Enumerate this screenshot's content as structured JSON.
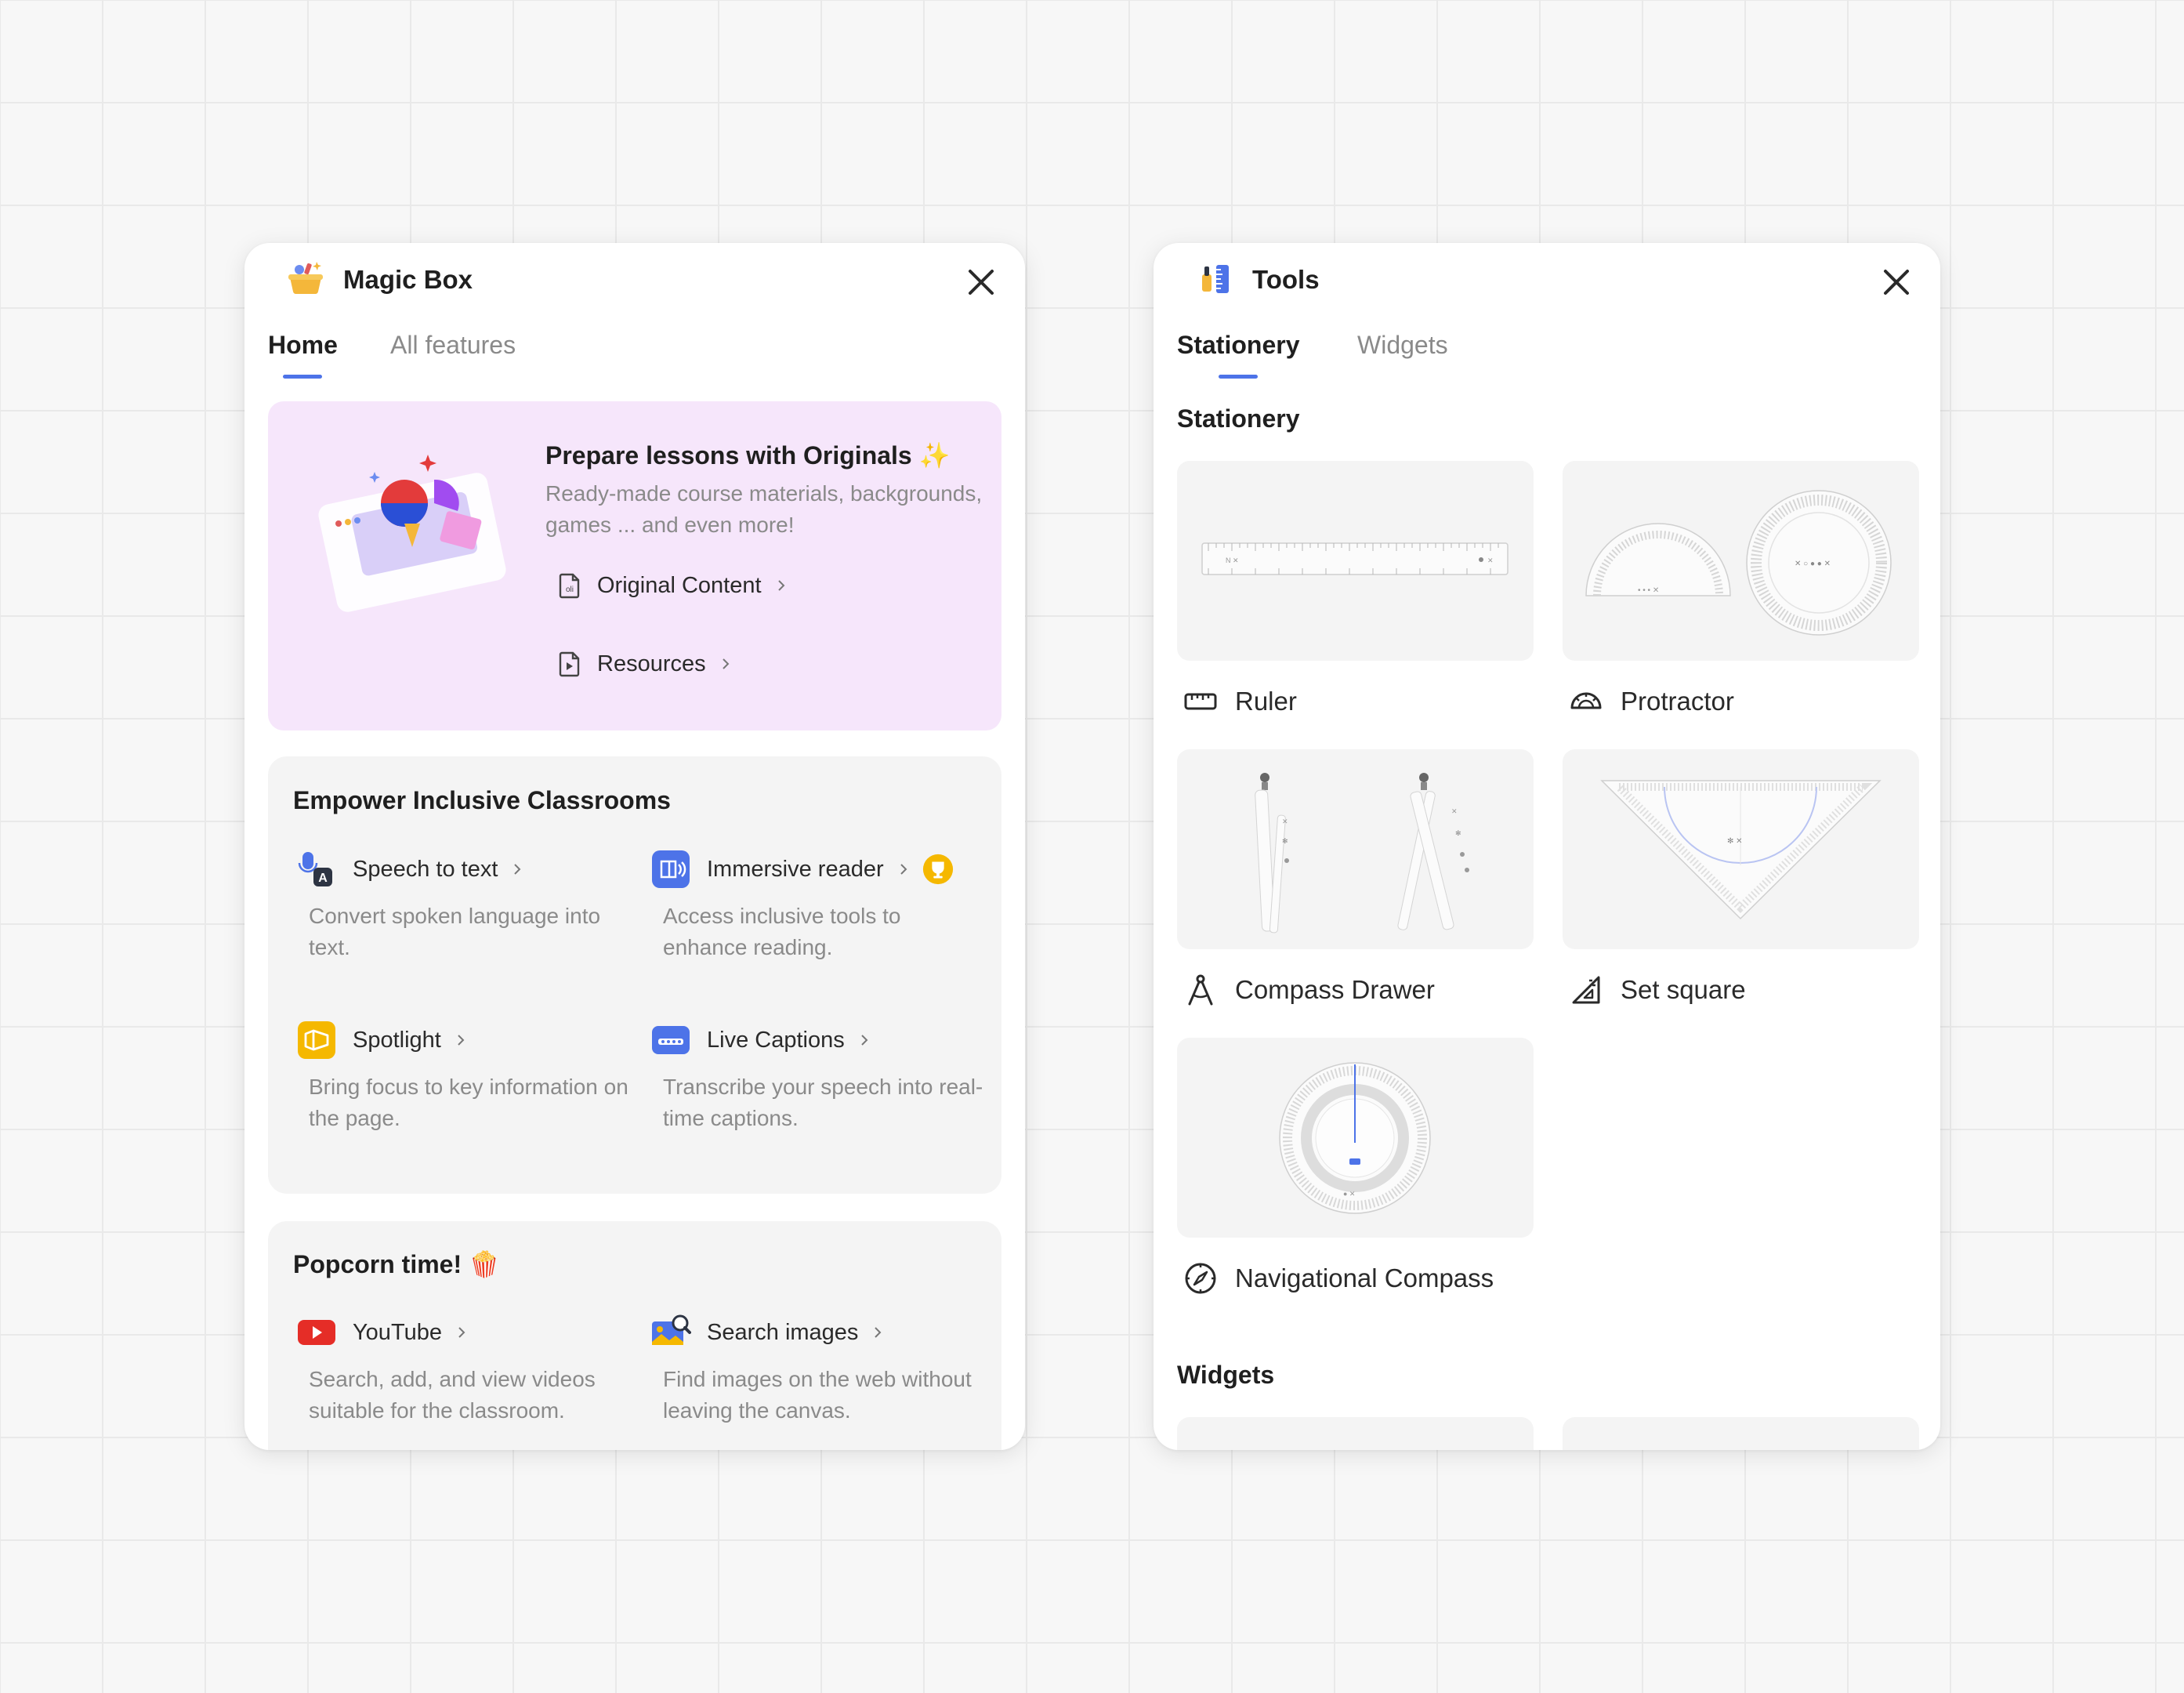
{
  "magic_box": {
    "title": "Magic Box",
    "tabs": [
      {
        "label": "Home",
        "active": true
      },
      {
        "label": "All features",
        "active": false
      }
    ],
    "promo": {
      "title": "Prepare lessons with Originals",
      "title_emoji": "✨",
      "description": "Ready-made course materials, backgrounds, games ... and even more!",
      "links": [
        {
          "label": "Original Content",
          "icon": "document-icon"
        },
        {
          "label": "Resources",
          "icon": "play-document-icon"
        }
      ]
    },
    "inclusive": {
      "title": "Empower Inclusive Classrooms",
      "features": [
        {
          "name": "Speech to text",
          "description": "Convert spoken language into text.",
          "icon": "microphone-icon"
        },
        {
          "name": "Immersive reader",
          "description": "Access inclusive tools to enhance reading.",
          "icon": "immersive-reader-icon",
          "badge": "trophy-badge-icon"
        },
        {
          "name": "Spotlight",
          "description": "Bring focus to key information on the page.",
          "icon": "spotlight-icon"
        },
        {
          "name": "Live Captions",
          "description": "Transcribe your speech into real-time captions.",
          "icon": "captions-icon"
        }
      ]
    },
    "popcorn": {
      "title": "Popcorn time!",
      "title_emoji": "🍿",
      "features": [
        {
          "name": "YouTube",
          "description": "Search, add, and view videos suitable for the classroom.",
          "icon": "youtube-icon"
        },
        {
          "name": "Search images",
          "description": "Find images on the web without leaving the canvas.",
          "icon": "image-search-icon"
        }
      ]
    }
  },
  "tools": {
    "title": "Tools",
    "tabs": [
      {
        "label": "Stationery",
        "active": true
      },
      {
        "label": "Widgets",
        "active": false
      }
    ],
    "stationery_heading": "Stationery",
    "items": [
      {
        "label": "Ruler",
        "icon": "ruler-icon"
      },
      {
        "label": "Protractor",
        "icon": "protractor-icon"
      },
      {
        "label": "Compass Drawer",
        "icon": "compass-drawer-icon"
      },
      {
        "label": "Set square",
        "icon": "set-square-icon"
      },
      {
        "label": "Navigational Compass",
        "icon": "navigational-compass-icon"
      }
    ],
    "widgets_heading": "Widgets"
  },
  "colors": {
    "accent": "#4d73e8",
    "promo_bg": "#f6e6fb",
    "card_bg": "#f4f4f4",
    "muted_text": "#8a8a8a"
  }
}
